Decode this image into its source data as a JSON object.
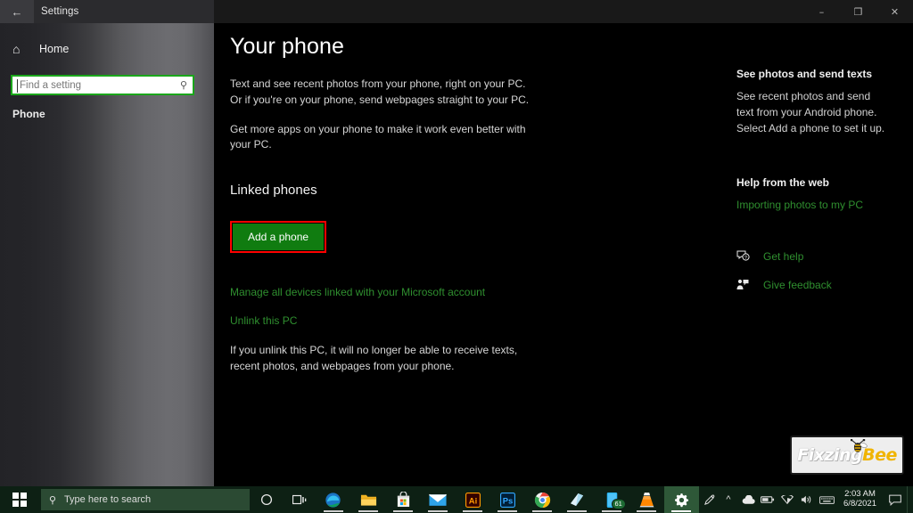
{
  "window": {
    "back_icon": "back-arrow-icon",
    "title": "Settings",
    "minimize_label": "–",
    "maximize_label": "❐",
    "close_label": "✕"
  },
  "sidebar": {
    "home_icon": "home-icon",
    "home_label": "Home",
    "search": {
      "value": "",
      "placeholder": "Find a setting",
      "icon": "search-icon"
    },
    "section_label": "Phone"
  },
  "main": {
    "page_title": "Your phone",
    "paragraph1": "Text and see recent photos from your phone, right on your PC. Or if you're on your phone, send webpages straight to your PC.",
    "paragraph2": "Get more apps on your phone to make it work even better with your PC.",
    "section_heading": "Linked phones",
    "add_phone_button": "Add a phone",
    "highlight_color": "#ff0000",
    "button_color": "#107c10",
    "link_manage": "Manage all devices linked with your Microsoft account",
    "link_unlink": "Unlink this PC",
    "note": "If you unlink this PC, it will no longer be able to receive texts, recent photos, and webpages from your phone."
  },
  "right_panel": {
    "heading1": "See photos and send texts",
    "text1": "See recent photos and send text from your Android phone. Select Add a phone to set it up.",
    "heading2": "Help from the web",
    "link1": "Importing photos to my PC",
    "actions": [
      {
        "icon": "help-bubble-icon",
        "label": "Get help"
      },
      {
        "icon": "feedback-person-icon",
        "label": "Give feedback"
      }
    ],
    "link_color": "#2f8f2f"
  },
  "watermark": {
    "text_a": "Fixzing",
    "text_b": "Bee"
  },
  "taskbar": {
    "start_icon": "windows-start-icon",
    "search": {
      "icon": "search-icon",
      "placeholder": "Type here to search"
    },
    "cortana_icon": "cortana-circle-icon",
    "taskview_icon": "task-view-icon",
    "apps": [
      {
        "name": "edge-icon",
        "label": "Microsoft Edge",
        "running": true,
        "active": false,
        "badge": ""
      },
      {
        "name": "file-explorer-icon",
        "label": "File Explorer",
        "running": true,
        "active": false,
        "badge": ""
      },
      {
        "name": "microsoft-store-icon",
        "label": "Microsoft Store",
        "running": true,
        "active": false,
        "badge": ""
      },
      {
        "name": "mail-icon",
        "label": "Mail",
        "running": true,
        "active": false,
        "badge": ""
      },
      {
        "name": "illustrator-icon",
        "label": "Adobe Illustrator",
        "running": true,
        "active": false,
        "badge": ""
      },
      {
        "name": "photoshop-icon",
        "label": "Adobe Photoshop",
        "running": true,
        "active": false,
        "badge": ""
      },
      {
        "name": "chrome-icon",
        "label": "Google Chrome",
        "running": true,
        "active": false,
        "badge": ""
      },
      {
        "name": "office-icon",
        "label": "Office",
        "running": true,
        "active": false,
        "badge": ""
      },
      {
        "name": "your-phone-icon",
        "label": "Your Phone",
        "running": true,
        "active": false,
        "badge": "61"
      },
      {
        "name": "vlc-icon",
        "label": "VLC media player",
        "running": true,
        "active": false,
        "badge": ""
      },
      {
        "name": "settings-icon",
        "label": "Settings",
        "running": true,
        "active": true,
        "badge": ""
      }
    ],
    "tray": {
      "pen_icon": "pen-workspace-icon",
      "chevron_icon": "show-hidden-icons-chevron",
      "onedrive_icon": "onedrive-cloud-icon",
      "battery_icon": "battery-icon",
      "network_icon": "wifi-icon",
      "volume_icon": "volume-icon",
      "keyboard_icon": "touch-keyboard-icon",
      "time": "2:03 AM",
      "date": "6/8/2021",
      "action_center_icon": "action-center-icon"
    }
  }
}
